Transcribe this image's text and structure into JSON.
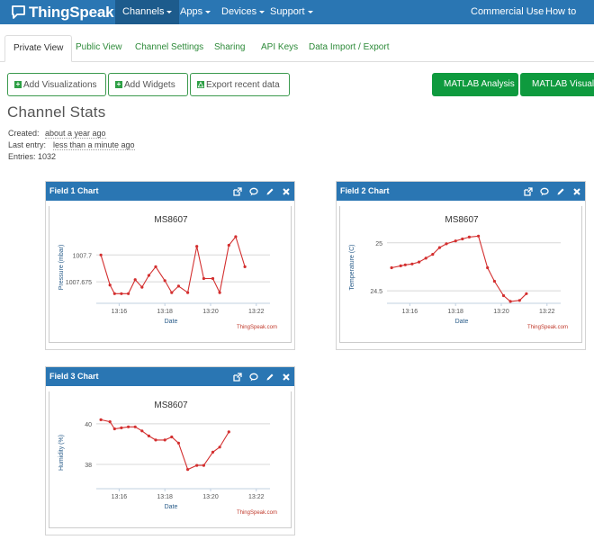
{
  "app": {
    "brand": "ThingSpeak",
    "tm": "™"
  },
  "nav": {
    "left": [
      {
        "label": "Channels",
        "active": true
      },
      {
        "label": "Apps"
      },
      {
        "label": "Devices"
      },
      {
        "label": "Support"
      }
    ],
    "right": [
      "Commercial Use",
      "How to Buy"
    ]
  },
  "tabs": [
    "Private View",
    "Public View",
    "Channel Settings",
    "Sharing",
    "API Keys",
    "Data Import / Export"
  ],
  "actions": {
    "add_visualizations": "Add Visualizations",
    "add_widgets": "Add Widgets",
    "export_recent": "Export recent data",
    "matlab_analysis": "MATLAB Analysis",
    "matlab_visualization": "MATLAB Visualiza"
  },
  "stats": {
    "heading": "Channel Stats",
    "created_label": "Created:",
    "created_value": "about a year ago",
    "last_entry_label": "Last entry:",
    "last_entry_value": "less than a minute ago",
    "entries_label": "Entries:",
    "entries_value": "1032"
  },
  "colors": {
    "navbar": "#2a76b3",
    "accent_green": "#0e9a3e",
    "series": "#d32f2f"
  },
  "chart_data": [
    {
      "type": "line",
      "panel_title": "Field 1 Chart",
      "title": "MS8607",
      "xlabel": "Date",
      "ylabel": "Pressure (mbar)",
      "credit": "ThingSpeak.com",
      "xticks": [
        "13:16",
        "13:18",
        "13:20",
        "13:22"
      ],
      "yticks": [
        "1007.7",
        "1007.675"
      ],
      "ytick_values": [
        1007.7,
        1007.675
      ],
      "ylim": [
        1007.655,
        1007.722
      ],
      "xlim": [
        15.0,
        22.6
      ],
      "x": [
        15.2,
        15.6,
        15.8,
        16.1,
        16.4,
        16.7,
        17.0,
        17.3,
        17.6,
        18.0,
        18.3,
        18.6,
        19.0,
        19.4,
        19.7,
        20.1,
        20.4,
        20.8,
        21.1,
        21.5,
        21.8,
        22.0,
        22.3
      ],
      "y": [
        1007.7,
        1007.672,
        1007.664,
        1007.664,
        1007.664,
        1007.677,
        1007.67,
        1007.681,
        1007.689,
        1007.676,
        1007.665,
        1007.671,
        1007.665,
        1007.708,
        1007.678,
        1007.678,
        1007.665,
        1007.709,
        1007.717,
        1007.689
      ]
    },
    {
      "type": "line",
      "panel_title": "Field 2 Chart",
      "title": "MS8607",
      "xlabel": "Date",
      "ylabel": "Temperature (C)",
      "credit": "ThingSpeak.com",
      "xticks": [
        "13:16",
        "13:18",
        "13:20",
        "13:22"
      ],
      "yticks": [
        "25",
        "24.5"
      ],
      "ytick_values": [
        25,
        24.5
      ],
      "ylim": [
        24.37,
        25.12
      ],
      "xlim": [
        15.0,
        22.6
      ],
      "x": [
        15.2,
        15.6,
        15.8,
        16.1,
        16.4,
        16.7,
        17.0,
        17.3,
        17.6,
        18.0,
        18.3,
        18.6,
        19.0,
        19.4,
        19.7,
        20.1,
        20.4,
        20.8,
        21.1,
        21.5,
        21.8,
        22.0,
        22.3
      ],
      "y": [
        24.74,
        24.76,
        24.77,
        24.78,
        24.8,
        24.84,
        24.88,
        24.95,
        24.99,
        25.02,
        25.04,
        25.06,
        25.07,
        24.74,
        24.6,
        24.45,
        24.39,
        24.4,
        24.47
      ]
    },
    {
      "type": "line",
      "panel_title": "Field 3 Chart",
      "title": "MS8607",
      "xlabel": "Date",
      "ylabel": "Humidity (%)",
      "credit": "ThingSpeak.com",
      "xticks": [
        "13:16",
        "13:18",
        "13:20",
        "13:22"
      ],
      "yticks": [
        "40",
        "38"
      ],
      "ytick_values": [
        40,
        38
      ],
      "ylim": [
        36.8,
        40.35
      ],
      "xlim": [
        15.0,
        22.6
      ],
      "x": [
        15.2,
        15.6,
        15.8,
        16.1,
        16.4,
        16.7,
        17.0,
        17.3,
        17.6,
        18.0,
        18.3,
        18.6,
        19.0,
        19.4,
        19.7,
        20.1,
        20.4,
        20.8,
        21.1,
        21.5,
        21.8,
        22.0,
        22.3
      ],
      "y": [
        40.2,
        40.1,
        39.75,
        39.8,
        39.85,
        39.85,
        39.65,
        39.4,
        39.2,
        39.2,
        39.35,
        39.05,
        37.75,
        37.95,
        37.95,
        38.6,
        38.85,
        39.6
      ]
    }
  ]
}
